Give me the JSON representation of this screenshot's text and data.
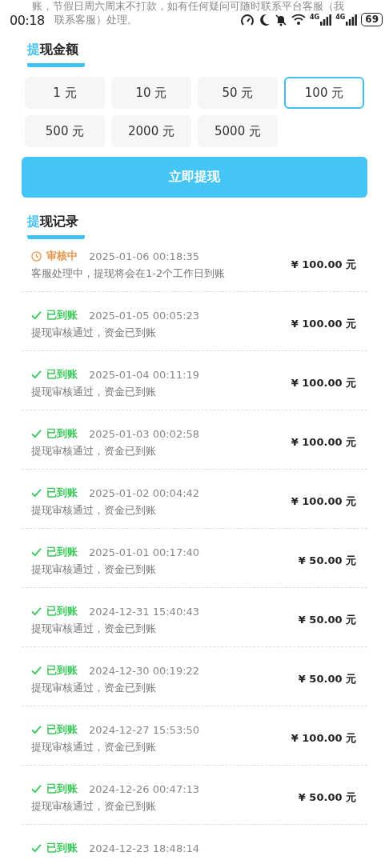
{
  "notice": {
    "line_1": "账，节假日周六周末不打款，如有任何疑问可随时联系平台客服（我",
    "line_2": "联系客服）处理。"
  },
  "status_bar": {
    "time": "00:18",
    "signals": [
      {
        "network": "4G"
      },
      {
        "network": "4G"
      }
    ],
    "battery": "69"
  },
  "amount_section": {
    "title_accent": "提",
    "title_rest": "现金额"
  },
  "amounts": [
    {
      "label": "1 元",
      "selected": false
    },
    {
      "label": "10 元",
      "selected": false
    },
    {
      "label": "50 元",
      "selected": false
    },
    {
      "label": "100 元",
      "selected": true
    },
    {
      "label": "500 元",
      "selected": false
    },
    {
      "label": "2000 元",
      "selected": false
    },
    {
      "label": "5000 元",
      "selected": false
    }
  ],
  "withdraw_button": "立即提现",
  "records_section": {
    "title_accent": "提",
    "title_rest": "现记录"
  },
  "records": [
    {
      "kind": "pending",
      "status": "审核中",
      "time": "2025-01-06 00:18:35",
      "note": "客服处理中，提现将会在1-2个工作日到账",
      "amount": "¥ 100.00 元"
    },
    {
      "kind": "done",
      "status": "已到账",
      "time": "2025-01-05 00:05:23",
      "note": "提现审核通过，资金已到账",
      "amount": "¥ 100.00 元"
    },
    {
      "kind": "done",
      "status": "已到账",
      "time": "2025-01-04 00:11:19",
      "note": "提现审核通过，资金已到账",
      "amount": "¥ 100.00 元"
    },
    {
      "kind": "done",
      "status": "已到账",
      "time": "2025-01-03 00:02:58",
      "note": "提现审核通过，资金已到账",
      "amount": "¥ 100.00 元"
    },
    {
      "kind": "done",
      "status": "已到账",
      "time": "2025-01-02 00:04:42",
      "note": "提现审核通过，资金已到账",
      "amount": "¥ 100.00 元"
    },
    {
      "kind": "done",
      "status": "已到账",
      "time": "2025-01-01 00:17:40",
      "note": "提现审核通过，资金已到账",
      "amount": "¥ 50.00 元"
    },
    {
      "kind": "done",
      "status": "已到账",
      "time": "2024-12-31 15:40:43",
      "note": "提现审核通过，资金已到账",
      "amount": "¥ 50.00 元"
    },
    {
      "kind": "done",
      "status": "已到账",
      "time": "2024-12-30 00:19:22",
      "note": "提现审核通过，资金已到账",
      "amount": "¥ 50.00 元"
    },
    {
      "kind": "done",
      "status": "已到账",
      "time": "2024-12-27 15:53:50",
      "note": "提现审核通过，资金已到账",
      "amount": "¥ 100.00 元"
    },
    {
      "kind": "done",
      "status": "已到账",
      "time": "2024-12-26 00:47:13",
      "note": "提现审核通过，资金已到账",
      "amount": "¥ 50.00 元"
    },
    {
      "kind": "done",
      "status": "已到账",
      "time": "2024-12-23 18:48:14"
    }
  ]
}
